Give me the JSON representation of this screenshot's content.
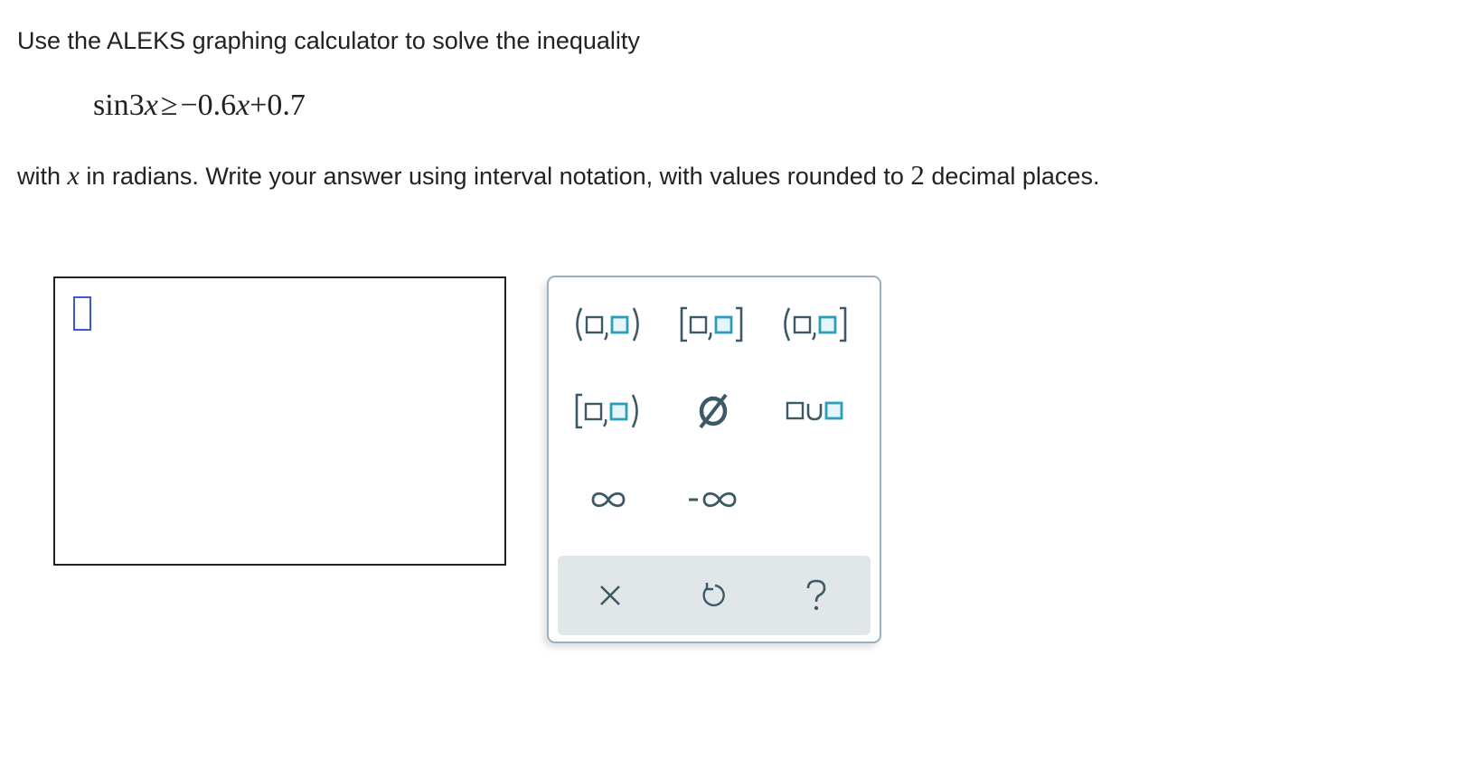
{
  "question": {
    "prompt": "Use the ALEKS graphing calculator to solve the inequality",
    "equation": {
      "lhs_fn": "sin",
      "lhs_coef": "3",
      "lhs_var": "x",
      "relation": "≥",
      "rhs_neg": "−0.6",
      "rhs_var": "x",
      "rhs_plus": "+",
      "rhs_const": "0.7"
    },
    "instructions": {
      "before_var": "with ",
      "var": "x",
      "middle": " in radians. Write your answer using interval notation, with values rounded to ",
      "decimals": "2",
      "after": " decimal places."
    }
  },
  "answer": {
    "value": ""
  },
  "keypad": {
    "keys": {
      "open_open": "open-open-interval-icon",
      "closed_closed": "closed-closed-interval-icon",
      "open_closed": "open-closed-interval-icon",
      "closed_open": "closed-open-interval-icon",
      "empty_set": "∅",
      "union": "∪",
      "infinity": "∞",
      "neg_infinity": "-∞"
    },
    "footer": {
      "clear": "×",
      "undo": "undo-icon",
      "help": "?"
    },
    "colors": {
      "text": "#3b5a66",
      "placeholder_outline": "#3b5a66",
      "placeholder_active": "#2a9fbc",
      "footer_bg": "#e1e6e9",
      "border": "#9ab0bf",
      "cursor": "#3a5ad1"
    }
  }
}
